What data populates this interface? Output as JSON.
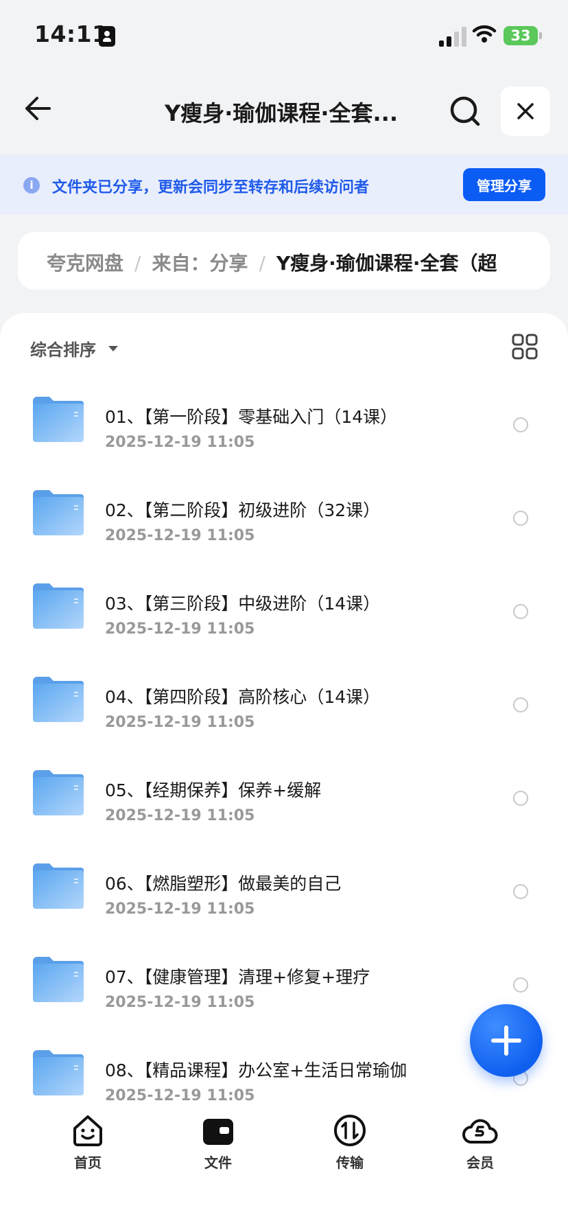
{
  "status_bar": {
    "time": "14:11",
    "battery": "33"
  },
  "header": {
    "title": "Y瘦身·瑜伽课程·全套..."
  },
  "banner": {
    "text": "文件夹已分享，更新会同步至转存和后续访问者",
    "button": "管理分享"
  },
  "breadcrumb": {
    "root": "夸克网盘",
    "middle": "来自：分享",
    "current": "Y瘦身·瑜伽课程·全套（超"
  },
  "sort": {
    "label": "综合排序"
  },
  "files": [
    {
      "name": "01、【第一阶段】零基础入门（14课）",
      "date": "2025-12-19 11:05"
    },
    {
      "name": "02、【第二阶段】初级进阶（32课）",
      "date": "2025-12-19 11:05"
    },
    {
      "name": "03、【第三阶段】中级进阶（14课）",
      "date": "2025-12-19 11:05"
    },
    {
      "name": "04、【第四阶段】高阶核心（14课）",
      "date": "2025-12-19 11:05"
    },
    {
      "name": "05、【经期保养】保养+缓解",
      "date": "2025-12-19 11:05"
    },
    {
      "name": "06、【燃脂塑形】做最美的自己",
      "date": "2025-12-19 11:05"
    },
    {
      "name": "07、【健康管理】清理+修复+理疗",
      "date": "2025-12-19 11:05"
    },
    {
      "name": "08、【精品课程】办公室+生活日常瑜伽",
      "date": "2025-12-19 11:05"
    }
  ],
  "tabs": [
    {
      "label": "首页",
      "icon": "smile-home-icon"
    },
    {
      "label": "文件",
      "icon": "wallet-folder-icon"
    },
    {
      "label": "传输",
      "icon": "transfer-icon"
    },
    {
      "label": "会员",
      "icon": "cloud-vip-icon"
    }
  ],
  "colors": {
    "accent": "#0b5cf5",
    "banner_bg": "#e9eefc",
    "folder": "#7fb8f4"
  }
}
